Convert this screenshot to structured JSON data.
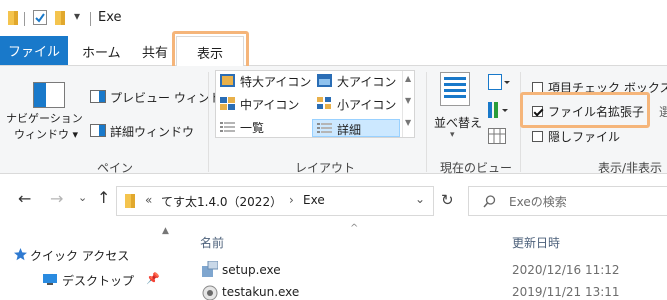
{
  "titlebar": {
    "title": "Exe",
    "qat_dropdown": "▾"
  },
  "tabs": {
    "file": "ファイル",
    "home": "ホーム",
    "share": "共有",
    "view": "表示"
  },
  "ribbon": {
    "pane_group": {
      "nav_pane_line1": "ナビゲーション",
      "nav_pane_line2": "ウィンドウ ▾",
      "preview_pane": "プレビュー ウィンドウ",
      "details_pane": "詳細ウィンドウ",
      "label": "ペイン"
    },
    "layout_group": {
      "xl_icons": "特大アイコン",
      "large_icons": "大アイコン",
      "medium_icons": "中アイコン",
      "small_icons": "小アイコン",
      "list": "一覧",
      "details": "詳細",
      "label": "レイアウト"
    },
    "current_view_group": {
      "sort_by": "並べ替え",
      "sort_by_arrow": "▾",
      "label": "現在のビュー"
    },
    "show_hide_group": {
      "item_checkboxes": "項目チェック ボックス",
      "item_checkboxes_checked": false,
      "file_name_extensions": "ファイル名拡張子",
      "file_name_extensions_checked": true,
      "hidden_items": "隠しファイル",
      "hidden_items_checked": false,
      "label": "表示/非表示"
    }
  },
  "address": {
    "overflow": "«",
    "crumb1": "てす太1.4.0（2022）",
    "sep": "›",
    "crumb2": "Exe",
    "search_placeholder": "Exeの検索"
  },
  "navpane": {
    "quick_access": "クイック アクセス",
    "desktop": "デスクトップ"
  },
  "filelist": {
    "col_name": "名前",
    "col_modified": "更新日時",
    "rows": [
      {
        "name": "setup.exe",
        "modified": "2020/12/16 11:12"
      },
      {
        "name": "testakun.exe",
        "modified": "2019/11/21 13:11"
      }
    ]
  },
  "colors": {
    "accent": "#1979ca",
    "highlight": "#f5b57a",
    "folder": "#f4c44e",
    "selection": "#cce8ff"
  }
}
